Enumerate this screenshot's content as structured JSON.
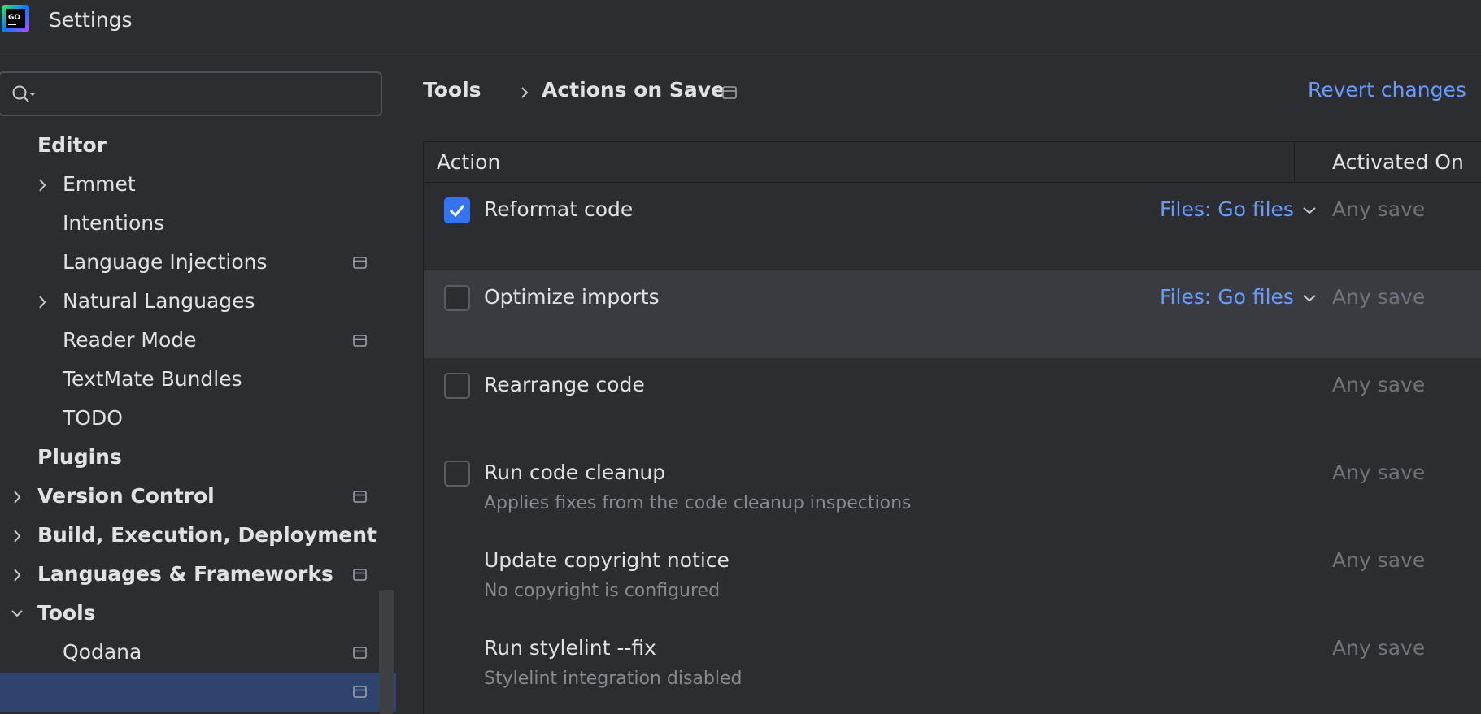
{
  "window": {
    "title": "Settings"
  },
  "search": {
    "value": "",
    "placeholder": ""
  },
  "sidebar": {
    "items": [
      {
        "label": "Editor",
        "bold": true,
        "indent": 0,
        "expand": "none",
        "project": false
      },
      {
        "label": "Emmet",
        "bold": false,
        "indent": 1,
        "expand": "collapsed",
        "project": false
      },
      {
        "label": "Intentions",
        "bold": false,
        "indent": 1,
        "expand": "none",
        "project": false
      },
      {
        "label": "Language Injections",
        "bold": false,
        "indent": 1,
        "expand": "none",
        "project": true
      },
      {
        "label": "Natural Languages",
        "bold": false,
        "indent": 1,
        "expand": "collapsed",
        "project": false
      },
      {
        "label": "Reader Mode",
        "bold": false,
        "indent": 1,
        "expand": "none",
        "project": true
      },
      {
        "label": "TextMate Bundles",
        "bold": false,
        "indent": 1,
        "expand": "none",
        "project": false
      },
      {
        "label": "TODO",
        "bold": false,
        "indent": 1,
        "expand": "none",
        "project": false
      },
      {
        "label": "Plugins",
        "bold": true,
        "indent": 0,
        "expand": "none",
        "project": false
      },
      {
        "label": "Version Control",
        "bold": true,
        "indent": 0,
        "expand": "collapsed",
        "project": true
      },
      {
        "label": "Build, Execution, Deployment",
        "bold": true,
        "indent": 0,
        "expand": "collapsed",
        "project": false
      },
      {
        "label": "Languages & Frameworks",
        "bold": true,
        "indent": 0,
        "expand": "collapsed",
        "project": true
      },
      {
        "label": "Tools",
        "bold": true,
        "indent": 0,
        "expand": "expanded",
        "project": false
      },
      {
        "label": "Qodana",
        "bold": false,
        "indent": 1,
        "expand": "none",
        "project": true
      },
      {
        "label": "",
        "bold": false,
        "indent": 1,
        "expand": "none",
        "project": true,
        "selected": true
      }
    ]
  },
  "breadcrumb": {
    "parent": "Tools",
    "current": "Actions on Save"
  },
  "header": {
    "revert_label": "Revert changes"
  },
  "table": {
    "columns": {
      "action": "Action",
      "activated_on": "Activated On"
    },
    "rows": [
      {
        "title": "Reformat code",
        "description": "",
        "checked": true,
        "has_checkbox": true,
        "scope": "Files: Go files",
        "activated_on": "Any save",
        "highlighted": false
      },
      {
        "title": "Optimize imports",
        "description": "",
        "checked": false,
        "has_checkbox": true,
        "scope": "Files: Go files",
        "activated_on": "Any save",
        "highlighted": true
      },
      {
        "title": "Rearrange code",
        "description": "",
        "checked": false,
        "has_checkbox": true,
        "scope": "",
        "activated_on": "Any save",
        "highlighted": false
      },
      {
        "title": "Run code cleanup",
        "description": "Applies fixes from the code cleanup inspections",
        "checked": false,
        "has_checkbox": true,
        "scope": "",
        "activated_on": "Any save",
        "highlighted": false
      },
      {
        "title": "Update copyright notice",
        "description": "No copyright is configured",
        "checked": false,
        "has_checkbox": false,
        "scope": "",
        "activated_on": "Any save",
        "highlighted": false
      },
      {
        "title": "Run stylelint --fix",
        "description": "Stylelint integration disabled",
        "checked": false,
        "has_checkbox": false,
        "scope": "",
        "activated_on": "Any save",
        "highlighted": false
      }
    ]
  },
  "colors": {
    "accent": "#3574f0",
    "link": "#6b9bfa",
    "background": "#2b2d30",
    "row_highlight": "#393b40",
    "selection": "#2e436e"
  },
  "icons": {
    "app": "goland-logo-icon",
    "search": "search-icon",
    "project": "project-level-icon",
    "chevron_right": "chevron-right-icon",
    "chevron_down": "chevron-down-icon",
    "check": "check-icon"
  }
}
